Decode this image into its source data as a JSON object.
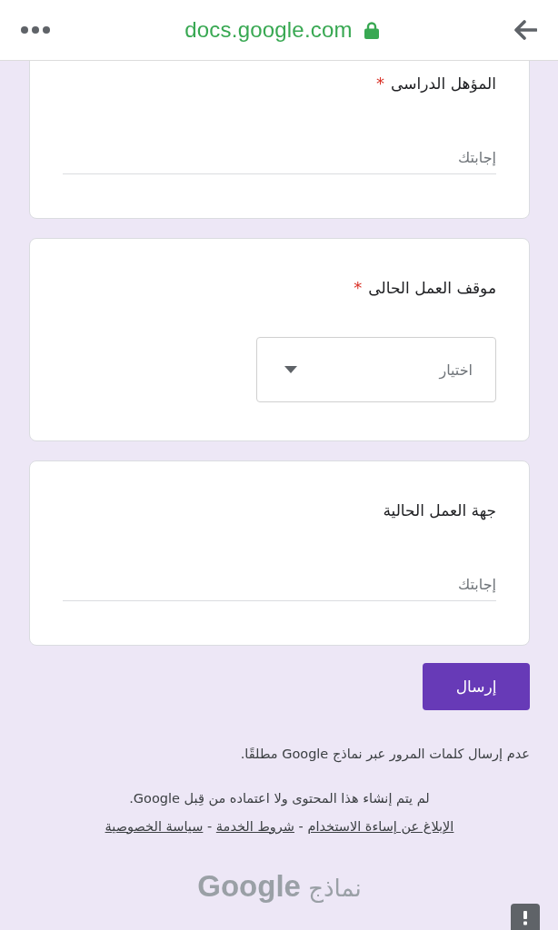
{
  "browser_bar": {
    "url": "docs.google.com",
    "secure": true
  },
  "questions": [
    {
      "kind": "text",
      "title": "المؤهل الدراسى",
      "required_mark": "*",
      "placeholder": "إجابتك"
    },
    {
      "kind": "dropdown",
      "title": "موقف العمل الحالى",
      "required_mark": "*",
      "placeholder": "اختيار"
    },
    {
      "kind": "text",
      "title": "جهة العمل الحالية",
      "placeholder": "إجابتك"
    }
  ],
  "submit_button": "إرسال",
  "password_notice": "عدم إرسال كلمات المرور عبر نماذج Google مطلقًا.",
  "disclaimer": {
    "text": "لم يتم إنشاء هذا المحتوى ولا اعتماده من قِبل Google.",
    "links": [
      {
        "label": "الإبلاغ عن إساءة الاستخدام"
      },
      {
        "separator": "-",
        "label": "شروط الخدمة"
      },
      {
        "separator": "-",
        "label": "سياسة الخصوصية"
      }
    ]
  },
  "brand": "نماذج **Google**"
}
